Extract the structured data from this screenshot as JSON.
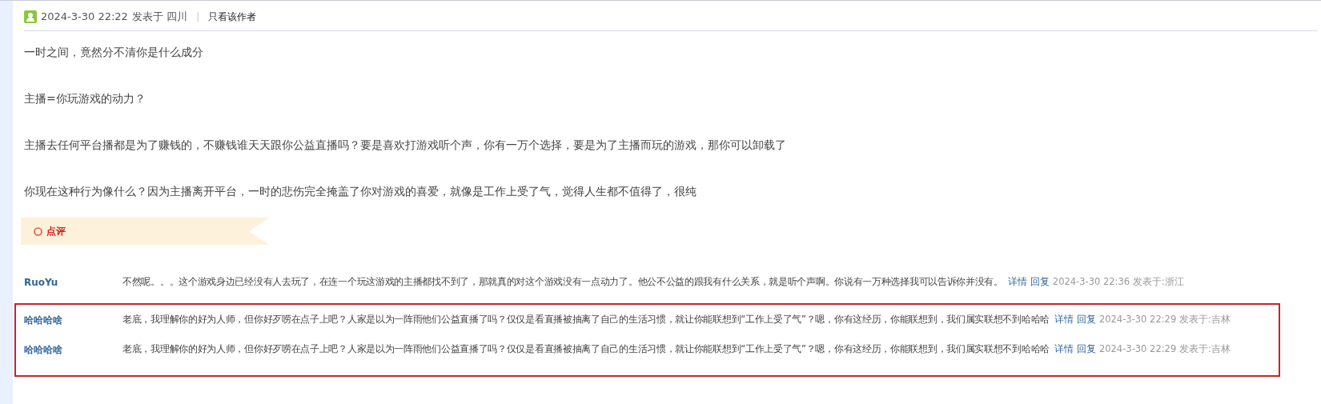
{
  "post_meta": {
    "datetime": "2024-3-30 22:22",
    "posted_in": "发表于 四川",
    "separator": "|",
    "author_only_link": "只看该作者"
  },
  "paragraphs": [
    "一时之间，竟然分不清你是什么成分",
    "主播=你玩游戏的动力？",
    "主播去任何平台播都是为了赚钱的，不赚钱谁天天跟你公益直播吗？要是喜欢打游戏听个声，你有一万个选择，要是为了主播而玩的游戏，那你可以卸载了",
    "你现在这种行为像什么？因为主播离开平台，一时的悲伤完全掩盖了你对游戏的喜爱，就像是工作上受了气，觉得人生都不值得了，很纯"
  ],
  "comments_banner": {
    "title": "点评"
  },
  "comment_groups": [
    {
      "highlighted": false,
      "comments": [
        {
          "user": "RuoYu",
          "text": "不然呢。。。这个游戏身边已经没有人去玩了，在连一个玩这游戏的主播都找不到了，那就真的对这个游戏没有一点动力了。他公不公益的跟我有什么关系，就是听个声啊。你说有一万种选择我可以告诉你并没有。",
          "details_link": "详情",
          "reply_link": "回复",
          "meta": "2024-3-30 22:36 发表于:浙江"
        }
      ]
    },
    {
      "highlighted": true,
      "comments": [
        {
          "user": "哈哈哈啥",
          "text": "老底，我理解你的好为人师，但你好歹唠在点子上吧？人家是以为一阵雨他们公益直播了吗？仅仅是看直播被抽离了自己的生活习惯，就让你能联想到“工作上受了气”？嗯，你有这经历，你能联想到，我们属实联想不到哈哈哈",
          "details_link": "详情",
          "reply_link": "回复",
          "meta": "2024-3-30 22:29 发表于:吉林"
        },
        {
          "user": "哈哈哈啥",
          "text": "老底，我理解你的好为人师，但你好歹唠在点子上吧？人家是以为一阵雨他们公益直播了吗？仅仅是看直播被抽离了自己的生活习惯，就让你能联想到“工作上受了气”？嗯，你有这经历，你能联想到，我们属实联想不到哈哈哈",
          "details_link": "详情",
          "reply_link": "回复",
          "meta": "2024-3-30 22:29 发表于:吉林"
        }
      ]
    }
  ]
}
